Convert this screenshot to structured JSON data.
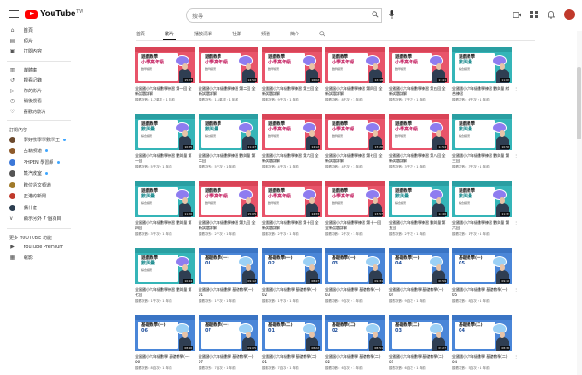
{
  "header": {
    "logo_text": "YouTube",
    "logo_region": "TW",
    "search_placeholder": "搜尋"
  },
  "sidebar": {
    "main": [
      {
        "icon": "home-icon",
        "label": "首頁",
        "glyph": "⌂"
      },
      {
        "icon": "shorts-icon",
        "label": "短片",
        "glyph": "▤"
      },
      {
        "icon": "subscriptions-icon",
        "label": "訂閱內容",
        "glyph": "▣"
      }
    ],
    "library": [
      {
        "icon": "library-icon",
        "label": "媒體庫",
        "glyph": "▥"
      },
      {
        "icon": "history-icon",
        "label": "觀看記錄",
        "glyph": "↺"
      },
      {
        "icon": "your-videos-icon",
        "label": "你的影片",
        "glyph": "▷"
      },
      {
        "icon": "watch-later-icon",
        "label": "稍後觀看",
        "glyph": "◷"
      },
      {
        "icon": "liked-icon",
        "label": "喜歡的影片",
        "glyph": "♡"
      }
    ],
    "subs_heading": "訂閱內容",
    "subs": [
      {
        "label": "學好數學學數學王",
        "color": "#6c4a2e"
      },
      {
        "label": "古籍頻道",
        "color": "#8e5a2a"
      },
      {
        "label": "PHPEN 學習網",
        "color": "#3c78d8"
      },
      {
        "label": "蒸汽教室",
        "color": "#555555"
      },
      {
        "label": "數位語文頻道",
        "color": "#a07a2a"
      },
      {
        "label": "正港的新聞",
        "color": "#c0392b"
      },
      {
        "label": "講什麼",
        "color": "#2c3e50"
      }
    ],
    "show_more": "顯示另外 7 個項目",
    "more_heading": "更多 YOUTUBE 功能",
    "more": [
      {
        "icon": "premium-icon",
        "label": "YouTube Premium",
        "glyph": "▶"
      },
      {
        "icon": "movies-icon",
        "label": "電影",
        "glyph": "▦"
      }
    ]
  },
  "tabs": [
    "首頁",
    "影片",
    "播放清單",
    "社群",
    "頻道",
    "簡介"
  ],
  "active_tab": 1,
  "videos": [
    [
      {
        "theme": "red",
        "l1": "遊戲教學",
        "l2": "小學高年級",
        "l3": "數學練習",
        "dur": "15:23",
        "title": "全國國小六年級數學練習 第一回 全新試題詳解",
        "meta": "觀看次數：1.7萬次・1 年前"
      },
      {
        "theme": "red",
        "l1": "遊戲教學",
        "l2": "小學高年級",
        "l3": "數學練習",
        "dur": "14:50",
        "title": "全國國小六年級數學練習 第二回 全新試題詳解",
        "meta": "觀看次數：1.1萬次・1 年前"
      },
      {
        "theme": "red",
        "l1": "遊戲教學",
        "l2": "小學高年級",
        "l3": "數學練習",
        "dur": "16:02",
        "title": "全國國小六年級數學練習 第三回 全新試題詳解",
        "meta": "觀看次數：9千次・1 年前"
      },
      {
        "theme": "red",
        "l1": "遊戲教學",
        "l2": "小學高年級",
        "l3": "數學練習",
        "dur": "12:18",
        "title": "全國國小六年級數學練習 第四回 全新試題詳解",
        "meta": "觀看次數：8千次・1 年前"
      },
      {
        "theme": "red",
        "l1": "遊戲教學",
        "l2": "小學高年級",
        "l3": "數學練習",
        "dur": "13:41",
        "title": "全國國小六年級數學練習 第五回 全新試題詳解",
        "meta": "觀看次數：7千次・1 年前"
      },
      {
        "theme": "teal",
        "l1": "遊戲教學",
        "l2": "數與量",
        "l3": "綜合練習",
        "dur": "11:09",
        "title": "全國國小六年級數學練習 數與量 綜合練習",
        "meta": "觀看次數：6千次・1 年前"
      }
    ],
    [
      {
        "theme": "teal",
        "l1": "遊戲教學",
        "l2": "數與量",
        "l3": "綜合練習",
        "dur": "10:35",
        "title": "全國國小六年級數學練習 數與量 第一回",
        "meta": "觀看次數：5千次・1 年前"
      },
      {
        "theme": "teal",
        "l1": "遊戲教學",
        "l2": "數與量",
        "l3": "綜合練習",
        "dur": "11:47",
        "title": "全國國小六年級數學練習 數與量 第二回",
        "meta": "觀看次數：5千次・1 年前"
      },
      {
        "theme": "red",
        "l1": "遊戲教學",
        "l2": "小學高年級",
        "l3": "數學練習",
        "dur": "14:12",
        "title": "全國國小六年級數學練習 第六回 全新試題詳解",
        "meta": "觀看次數：4千次・1 年前"
      },
      {
        "theme": "red",
        "l1": "遊戲教學",
        "l2": "小學高年級",
        "l3": "數學練習",
        "dur": "13:26",
        "title": "全國國小六年級數學練習 第七回 全新試題詳解",
        "meta": "觀看次數：4千次・1 年前"
      },
      {
        "theme": "red",
        "l1": "遊戲教學",
        "l2": "小學高年級",
        "l3": "數學練習",
        "dur": "12:54",
        "title": "全國國小六年級數學練習 第八回 全新試題詳解",
        "meta": "觀看次數：3千次・1 年前"
      },
      {
        "theme": "teal",
        "l1": "遊戲教學",
        "l2": "數與量",
        "l3": "綜合練習",
        "dur": "10:58",
        "title": "全國國小六年級數學練習 數與量 第三回",
        "meta": "觀看次數：3千次・1 年前"
      }
    ],
    [
      {
        "theme": "teal",
        "l1": "遊戲教學",
        "l2": "數與量",
        "l3": "綜合練習",
        "dur": "11:20",
        "title": "全國國小六年級數學練習 數與量 第四回",
        "meta": "觀看次數：3千次・1 年前"
      },
      {
        "theme": "red",
        "l1": "遊戲教學",
        "l2": "小學高年級",
        "l3": "數學練習",
        "dur": "15:05",
        "title": "全國國小六年級數學練習 第九回 全新試題詳解",
        "meta": "觀看次數：2千次・1 年前"
      },
      {
        "theme": "red",
        "l1": "遊戲教學",
        "l2": "小學高年級",
        "l3": "數學練習",
        "dur": "14:33",
        "title": "全國國小六年級數學練習 第十回 全新試題詳解",
        "meta": "觀看次數：2千次・1 年前"
      },
      {
        "theme": "red",
        "l1": "遊戲教學",
        "l2": "小學高年級",
        "l3": "數學練習",
        "dur": "13:57",
        "title": "全國國小六年級數學練習 第十一回 全新試題詳解",
        "meta": "觀看次數：2千次・1 年前"
      },
      {
        "theme": "teal",
        "l1": "遊戲教學",
        "l2": "數與量",
        "l3": "綜合練習",
        "dur": "12:40",
        "title": "全國國小六年級數學練習 數與量 第五回",
        "meta": "觀看次數：2千次・1 年前"
      },
      {
        "theme": "teal",
        "l1": "遊戲教學",
        "l2": "數與量",
        "l3": "綜合練習",
        "dur": "11:33",
        "title": "全國國小六年級數學練習 數與量 第六回",
        "meta": "觀看次數：1千次・1 年前"
      }
    ],
    [
      {
        "theme": "teal",
        "l1": "遊戲教學",
        "l2": "數與量",
        "l3": "綜合練習",
        "dur": "10:44",
        "title": "全國國小六年級數學練習 數與量 第七回",
        "meta": "觀看次數：1千次・1 年前"
      },
      {
        "theme": "blue",
        "l1": "基礎教學(一)",
        "l2": "",
        "l3": "01",
        "dur": "09:12",
        "title": "全國國小六年級數學 基礎教學(一) 01",
        "meta": "觀看次數：1千次・1 年前"
      },
      {
        "theme": "blue",
        "l1": "基礎教學(一)",
        "l2": "",
        "l3": "02",
        "dur": "08:47",
        "title": "全國國小六年級數學 基礎教學(一) 02",
        "meta": "觀看次數：1千次・1 年前"
      },
      {
        "theme": "blue",
        "l1": "基礎教學(一)",
        "l2": "",
        "l3": "03",
        "dur": "09:31",
        "title": "全國國小六年級數學 基礎教學(一) 03",
        "meta": "觀看次數：9百次・1 年前"
      },
      {
        "theme": "blue",
        "l1": "基礎教學(一)",
        "l2": "",
        "l3": "04",
        "dur": "08:59",
        "title": "全國國小六年級數學 基礎教學(一) 04",
        "meta": "觀看次數：9百次・1 年前"
      },
      {
        "theme": "blue",
        "l1": "基礎教學(一)",
        "l2": "",
        "l3": "05",
        "dur": "09:16",
        "title": "全國國小六年級數學 基礎教學(一) 05",
        "meta": "觀看次數：8百次・1 年前"
      }
    ],
    [
      {
        "theme": "blue",
        "l1": "基礎教學(一)",
        "l2": "",
        "l3": "06",
        "dur": "08:40",
        "title": "全國國小六年級數學 基礎教學(一) 06",
        "meta": "觀看次數：8百次・1 年前"
      },
      {
        "theme": "blue",
        "l1": "基礎教學(一)",
        "l2": "",
        "l3": "07",
        "dur": "09:05",
        "title": "全國國小六年級數學 基礎教學(一) 07",
        "meta": "觀看次數：7百次・1 年前"
      },
      {
        "theme": "blue",
        "l1": "基礎教學(二)",
        "l2": "",
        "l3": "01",
        "dur": "08:22",
        "title": "全國國小六年級數學 基礎教學(二) 01",
        "meta": "觀看次數：7百次・1 年前"
      },
      {
        "theme": "blue",
        "l1": "基礎教學(二)",
        "l2": "",
        "l3": "02",
        "dur": "08:51",
        "title": "全國國小六年級數學 基礎教學(二) 02",
        "meta": "觀看次數：6百次・1 年前"
      },
      {
        "theme": "blue",
        "l1": "基礎教學(二)",
        "l2": "",
        "l3": "03",
        "dur": "09:27",
        "title": "全國國小六年級數學 基礎教學(二) 03",
        "meta": "觀看次數：6百次・1 年前"
      },
      {
        "theme": "blue",
        "l1": "基礎教學(二)",
        "l2": "",
        "l3": "04",
        "dur": "08:36",
        "title": "全國國小六年級數學 基礎教學(二) 04",
        "meta": "觀看次數：5百次・1 年前"
      }
    ]
  ],
  "themes": {
    "red": {
      "bg": "#e8546a",
      "band": "#d94457",
      "accent": "#c2185b",
      "bubble": "#8e7cf0"
    },
    "teal": {
      "bg": "#35b5b8",
      "band": "#2a9fa2",
      "accent": "#1b8a8d",
      "bubble": "#8e7cf0"
    },
    "blue": {
      "bg": "#4a86d8",
      "band": "#3a74c4",
      "accent": "#1f4e9a",
      "bubble": "#9bd0f5"
    }
  },
  "colors": {
    "brand_red": "#ff0000",
    "avatar": "#c0392b"
  }
}
